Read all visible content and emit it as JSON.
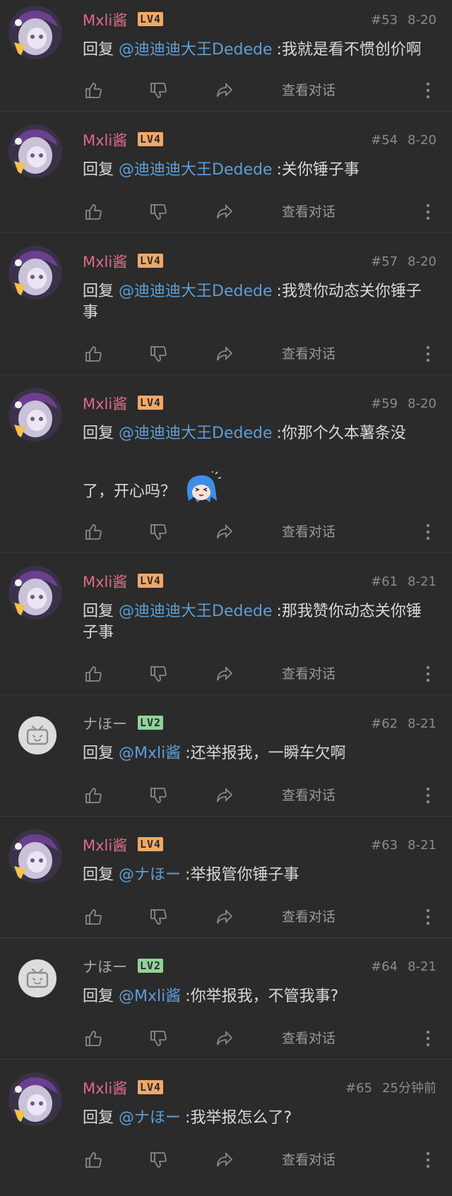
{
  "comments": [
    {
      "user": "Mxli酱",
      "level": "LV4",
      "floor": "#53",
      "date": "8-20",
      "reply_prefix": "回复",
      "at": "@迪迪迪大王Dedede",
      "text": "我就是看不惯创价啊",
      "view": "查看对话"
    },
    {
      "user": "Mxli酱",
      "level": "LV4",
      "floor": "#54",
      "date": "8-20",
      "reply_prefix": "回复",
      "at": "@迪迪迪大王Dedede",
      "text": "关你锤子事",
      "view": "查看对话"
    },
    {
      "user": "Mxli酱",
      "level": "LV4",
      "floor": "#57",
      "date": "8-20",
      "reply_prefix": "回复",
      "at": "@迪迪迪大王Dedede",
      "text": "我赞你动态关你锤子",
      "text_wrap": "事",
      "view": "查看对话"
    },
    {
      "user": "Mxli酱",
      "level": "LV4",
      "floor": "#59",
      "date": "8-20",
      "reply_prefix": "回复",
      "at": "@迪迪迪大王Dedede",
      "text": "你那个久本薯条没",
      "text_wrap": "了，开心吗？",
      "view": "查看对话"
    },
    {
      "user": "Mxli酱",
      "level": "LV4",
      "floor": "#61",
      "date": "8-21",
      "reply_prefix": "回复",
      "at": "@迪迪迪大王Dedede",
      "text": "那我赞你动态关你锤",
      "text_wrap": "子事",
      "view": "查看对话"
    },
    {
      "user": "ナほー",
      "level": "LV2",
      "floor": "#62",
      "date": "8-21",
      "reply_prefix": "回复",
      "at": "@Mxli酱",
      "text": "还举报我，一瞬车欠啊",
      "view": "查看对话"
    },
    {
      "user": "Mxli酱",
      "level": "LV4",
      "floor": "#63",
      "date": "8-21",
      "reply_prefix": "回复",
      "at": "@ナほー",
      "text": "举报管你锤子事",
      "view": "查看对话"
    },
    {
      "user": "ナほー",
      "level": "LV2",
      "floor": "#64",
      "date": "8-21",
      "reply_prefix": "回复",
      "at": "@Mxli酱",
      "text": "你举报我，不管我事?",
      "view": "查看对话"
    },
    {
      "user": "Mxli酱",
      "level": "LV4",
      "floor": "#65",
      "date": "25分钟前",
      "reply_prefix": "回复",
      "at": "@ナほー",
      "text": "我举报怎么了?",
      "view": "查看对话"
    }
  ],
  "separator": ":",
  "colors": {
    "background": "#2b2b2b",
    "username_pink": "#e06a88",
    "username_gray": "#a7a7a7",
    "mention_blue": "#5d9ed8",
    "lv4": "#f0a868",
    "lv2": "#8fd39a"
  },
  "icons": [
    "thumbs-up-icon",
    "thumbs-down-icon",
    "share-icon",
    "more-vertical-icon",
    "bilibili-tv-avatar-icon",
    "anime-avatar-icon",
    "blue-hair-emoji-icon"
  ]
}
